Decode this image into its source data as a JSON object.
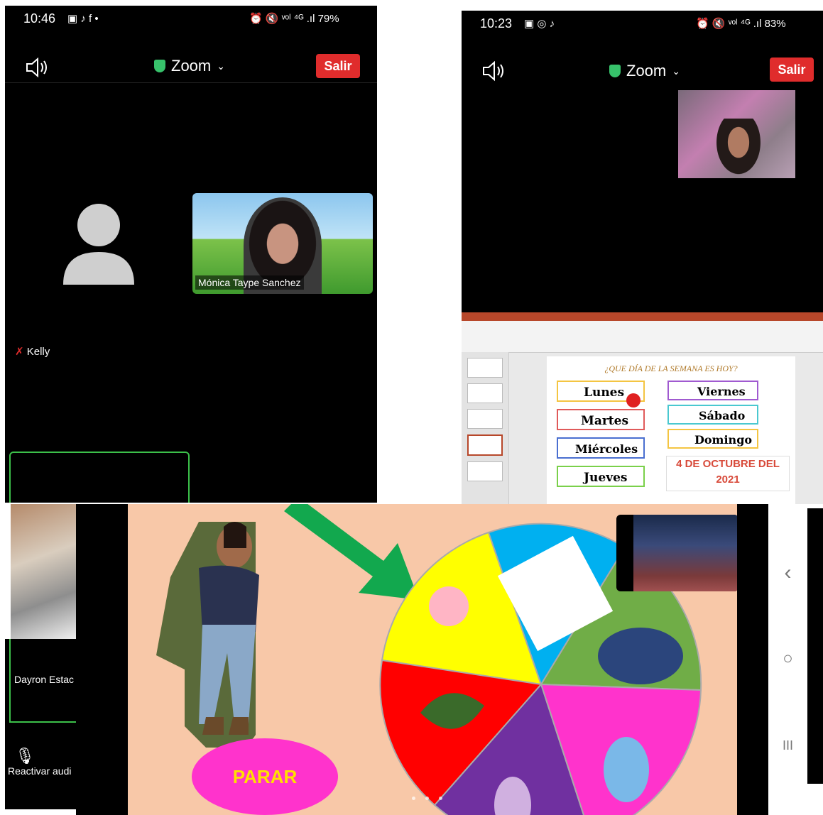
{
  "left_phone": {
    "status_time": "10:46",
    "status_left_icons": "▣ ♪ f •",
    "status_right": "⏰ 🔇 ᵛᵒˡ ⁴ᴳ .ıl 79%",
    "title": "Zoom",
    "exit_label": "Salir",
    "speaker_icon": "speaker-icon",
    "participant_1": "Kelly",
    "participant_2": "Mónica Taype Sanchez",
    "participant_3": "Dayron Estac",
    "bottom_label": "Reactivar audi"
  },
  "right_phone": {
    "status_time": "10:23",
    "status_left_icons": "▣ ◎ ♪",
    "status_right": "⏰ 🔇 ᵛᵒˡ ⁴ᴳ .ıl 83%",
    "title": "Zoom",
    "exit_label": "Salir",
    "slide": {
      "question": "¿QUE DÍA DE LA SEMANA ES HOY?",
      "days_left": [
        "Lunes",
        "Martes",
        "Miércoles",
        "Jueves"
      ],
      "days_right": [
        "Viernes",
        "Sábado",
        "Domingo"
      ],
      "date_line1": "4 DE OCTUBRE DEL",
      "date_line2": "2021"
    }
  },
  "bottom_game": {
    "stop_button": "PARAR",
    "wheel_colors": [
      "#ffff00",
      "#00b0f0",
      "#70ad47",
      "#ff33cc",
      "#7030a0",
      "#ff0000"
    ],
    "arrow_color": "#12a84e",
    "background": "#f8c8a8"
  },
  "android_nav": {
    "back": "‹",
    "home": "○",
    "recent": "III"
  },
  "colors": {
    "zoom_shield": "#37c26b",
    "salir": "#e02c2c",
    "active_border": "#3cc04a"
  }
}
